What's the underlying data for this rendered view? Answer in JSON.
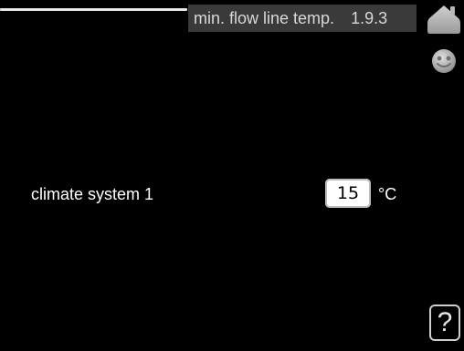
{
  "header": {
    "title": "min. flow line temp.",
    "menu_code": "1.9.3"
  },
  "icons": {
    "home": "home-icon",
    "globe": "globe-icon",
    "help": "help-icon"
  },
  "setting": {
    "label": "climate system 1",
    "value": "15",
    "unit": "°C"
  },
  "help": {
    "label": "?"
  },
  "colors": {
    "background": "#000000",
    "title_bar": "#3a3a3a",
    "title_text": "#d8d8d8",
    "text": "#ffffff",
    "value_box": "#ffffff"
  }
}
